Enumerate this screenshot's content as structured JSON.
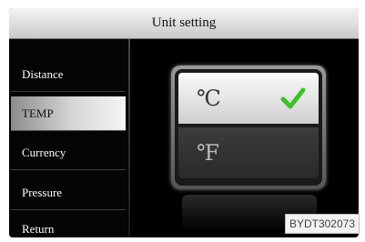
{
  "header": {
    "title": "Unit setting"
  },
  "sidebar": {
    "items": [
      {
        "label": "Distance"
      },
      {
        "label": "TEMP"
      },
      {
        "label": "Currency"
      },
      {
        "label": "Pressure"
      },
      {
        "label": "Return"
      }
    ]
  },
  "units": {
    "celsius": "℃",
    "fahrenheit": "℉",
    "selected": "celsius",
    "check_icon": "checkmark-icon",
    "check_color": "#3fbf2a"
  },
  "watermark": "BYDT302073"
}
